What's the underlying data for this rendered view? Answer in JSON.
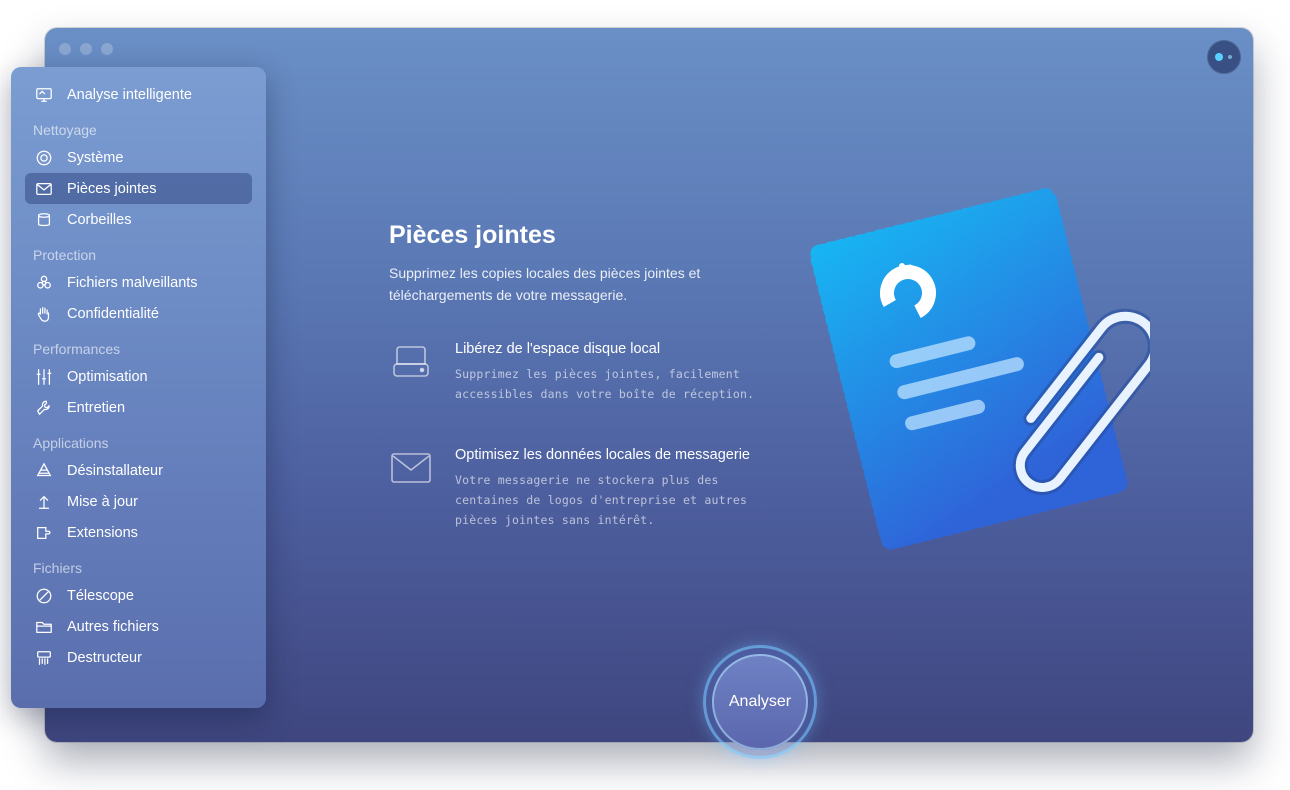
{
  "sidebar": {
    "top_item": {
      "label": "Analyse intelligente",
      "icon": "monitor-icon"
    },
    "sections": [
      {
        "heading": "Nettoyage",
        "items": [
          {
            "label": "Système",
            "icon": "system-icon"
          },
          {
            "label": "Pièces jointes",
            "icon": "mail-icon",
            "active": true
          },
          {
            "label": "Corbeilles",
            "icon": "trash-bin-icon"
          }
        ]
      },
      {
        "heading": "Protection",
        "items": [
          {
            "label": "Fichiers malveillants",
            "icon": "biohazard-icon"
          },
          {
            "label": "Confidentialité",
            "icon": "hand-icon"
          }
        ]
      },
      {
        "heading": "Performances",
        "items": [
          {
            "label": "Optimisation",
            "icon": "sliders-icon"
          },
          {
            "label": "Entretien",
            "icon": "wrench-icon"
          }
        ]
      },
      {
        "heading": "Applications",
        "items": [
          {
            "label": "Désinstallateur",
            "icon": "uninstaller-icon"
          },
          {
            "label": "Mise à jour",
            "icon": "update-arrow-icon"
          },
          {
            "label": "Extensions",
            "icon": "extension-icon"
          }
        ]
      },
      {
        "heading": "Fichiers",
        "items": [
          {
            "label": "Télescope",
            "icon": "lens-icon"
          },
          {
            "label": "Autres fichiers",
            "icon": "folder-icon"
          },
          {
            "label": "Destructeur",
            "icon": "shredder-icon"
          }
        ]
      }
    ]
  },
  "main": {
    "title": "Pièces jointes",
    "subtitle": "Supprimez les copies locales des pièces jointes et téléchargements de votre messagerie.",
    "features": [
      {
        "icon": "disk-drive-icon",
        "title": "Libérez de l'espace disque local",
        "description": "Supprimez les pièces jointes, facilement accessibles dans votre boîte de réception."
      },
      {
        "icon": "envelope-icon",
        "title": "Optimisez les données locales de messagerie",
        "description": "Votre messagerie ne stockera plus des centaines de logos d'entreprise et autres pièces jointes sans intérêt."
      }
    ],
    "scan_button": "Analyser"
  },
  "colors": {
    "window_top": "#6a8fc6",
    "window_bottom": "#3f467f",
    "stamp_top": "#18b4f2",
    "stamp_bottom": "#2f63d8",
    "scan_ring": "#78c8ff"
  }
}
